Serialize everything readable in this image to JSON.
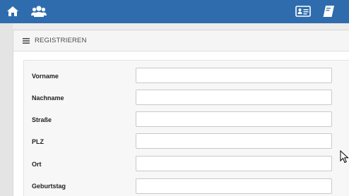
{
  "topbar": {
    "color": "#2f6cae",
    "icons": [
      "home-icon",
      "users-icon",
      "id-card-icon",
      "book-icon"
    ]
  },
  "panel": {
    "title": "REGISTRIEREN",
    "title_icon": "menu-lines-icon"
  },
  "form": {
    "fields": [
      {
        "label": "Vorname",
        "value": ""
      },
      {
        "label": "Nachname",
        "value": ""
      },
      {
        "label": "Straße",
        "value": ""
      },
      {
        "label": "PLZ",
        "value": ""
      },
      {
        "label": "Ort",
        "value": ""
      },
      {
        "label": "Geburtstag",
        "value": ""
      }
    ]
  }
}
